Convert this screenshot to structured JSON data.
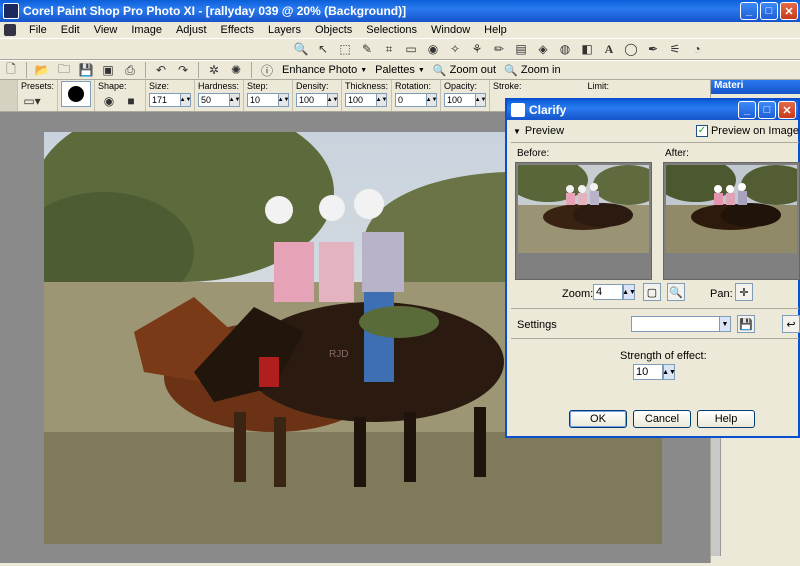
{
  "window": {
    "title": "Corel Paint Shop Pro Photo XI - [rallyday 039 @  20% (Background)]",
    "minimize": "_",
    "maximize": "□",
    "close": "✕"
  },
  "menu": [
    "File",
    "Edit",
    "View",
    "Image",
    "Adjust",
    "Effects",
    "Layers",
    "Objects",
    "Selections",
    "Window",
    "Help"
  ],
  "standard_toolbar": {
    "enhance_photo": "Enhance Photo",
    "palettes": "Palettes",
    "zoom_out": "Zoom out",
    "zoom_in": "Zoom in"
  },
  "tool_options": {
    "presets_label": "Presets:",
    "shape_label": "Shape:",
    "size": {
      "label": "Size:",
      "value": "171"
    },
    "hardness": {
      "label": "Hardness:",
      "value": "50"
    },
    "step": {
      "label": "Step:",
      "value": "10"
    },
    "density": {
      "label": "Density:",
      "value": "100"
    },
    "thickness": {
      "label": "Thickness:",
      "value": "100"
    },
    "rotation": {
      "label": "Rotation:",
      "value": "0"
    },
    "opacity": {
      "label": "Opacity:",
      "value": "100"
    },
    "stroke_label": "Stroke:",
    "limit_label": "Limit:"
  },
  "materials": {
    "title": "Materi"
  },
  "photo": {
    "watermark": "RJD"
  },
  "dialog": {
    "title": "Clarify",
    "preview_toggle": "Preview",
    "preview_on_image": "Preview on Image",
    "before_label": "Before:",
    "after_label": "After:",
    "zoom_label": "Zoom:",
    "zoom_value": "4",
    "pan_label": "Pan:",
    "settings_label": "Settings",
    "settings_value": "",
    "strength_label": "Strength of effect:",
    "strength_value": "10",
    "ok": "OK",
    "cancel": "Cancel",
    "help": "Help"
  },
  "colors": {
    "titlebar": "#1553c9",
    "dialog_bg": "#ece9d8",
    "workspace": "#8a8a8a"
  }
}
